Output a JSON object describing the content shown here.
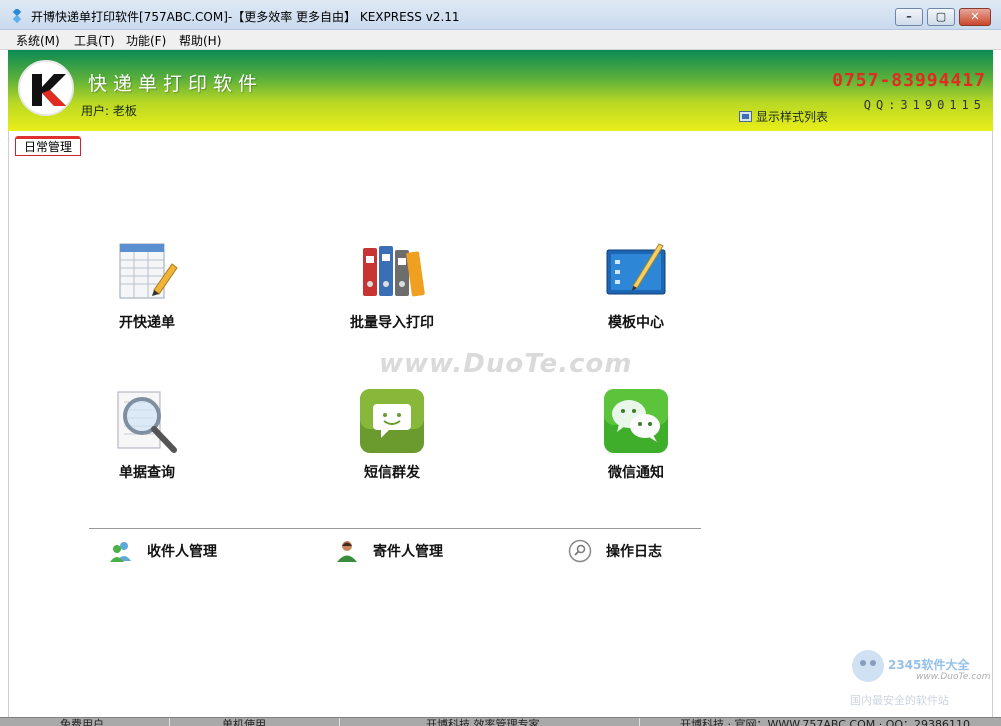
{
  "window": {
    "title": "开博快递单打印软件[757ABC.COM]-【更多效率 更多自由】  KEXPRESS v2.11",
    "buttons": {
      "minimize": "–",
      "maximize": "▢",
      "close": "✕"
    }
  },
  "menu": [
    "系统(M)",
    "工具(T)",
    "功能(F)",
    "帮助(H)"
  ],
  "banner": {
    "logo_letter": "K",
    "app_name": "快递单打印软件",
    "user_label": "用户: 老板",
    "phone": "0757-83994417",
    "qq": "QQ:3190115",
    "style_list_label": "显示样式列表"
  },
  "tab": {
    "label": "日常管理"
  },
  "features": [
    {
      "label": "开快递单",
      "icon": "spreadsheet-pencil-icon"
    },
    {
      "label": "批量导入打印",
      "icon": "binders-icon"
    },
    {
      "label": "模板中心",
      "icon": "template-board-icon"
    },
    {
      "label": "单据查询",
      "icon": "magnifier-document-icon"
    },
    {
      "label": "短信群发",
      "icon": "sms-message-icon"
    },
    {
      "label": "微信通知",
      "icon": "wechat-icon"
    }
  ],
  "links": [
    {
      "label": "收件人管理",
      "icon": "contacts-icon"
    },
    {
      "label": "寄件人管理",
      "icon": "person-icon"
    },
    {
      "label": "操作日志",
      "icon": "search-circle-icon"
    }
  ],
  "watermark": {
    "center": "www.DuoTe.com",
    "corner_brand": "2345软件大全",
    "corner_site": "www.DuoTe.com",
    "corner_tag": "国内最安全的软件站"
  },
  "status": [
    "免费用户",
    "单机使用",
    "开博科技  效率管理专家",
    "开博科技 · 官网：WWW.757ABC.COM · QQ：29386110"
  ],
  "colors": {
    "accent_red": "#e22b20",
    "banner_green": "#0a8a55",
    "banner_yellow": "#e9ee1a"
  }
}
